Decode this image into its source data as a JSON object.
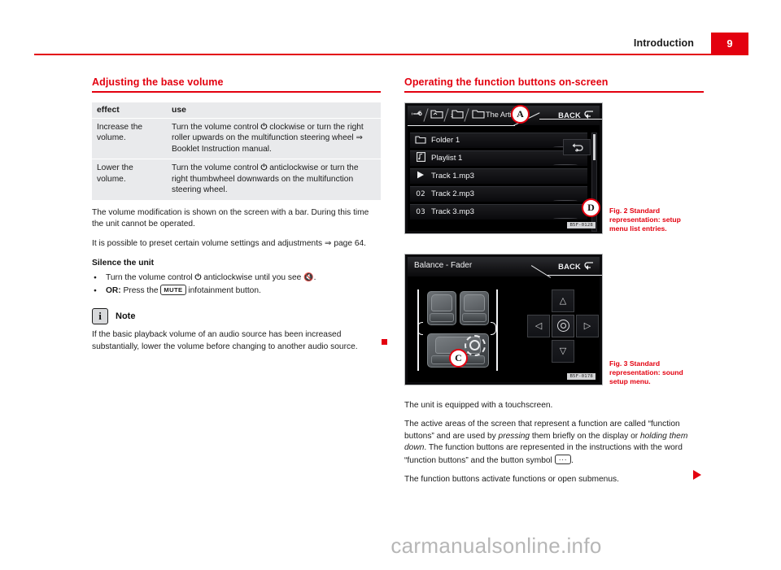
{
  "header": {
    "title": "Introduction",
    "page_number": "9",
    "accent_color": "#e3000f"
  },
  "left_column": {
    "section_title": "Adjusting the base volume",
    "table": {
      "headers": [
        "effect",
        "use"
      ],
      "rows": [
        {
          "effect": "Increase the volume.",
          "use_pre": "Turn the volume control ",
          "use_glyph": "⏻",
          "use_post": " clockwise or turn the right roller upwards on the multifunction steering wheel ⇒ Booklet Instruction manual."
        },
        {
          "effect": "Lower the volume.",
          "use_pre": "Turn the volume control ",
          "use_glyph": "⏻",
          "use_post": " anticlockwise or turn the right thumbwheel downwards on the multifunction steering wheel."
        }
      ]
    },
    "paragraph_1": "The volume modification is shown on the screen with a bar. During this time the unit cannot be operated.",
    "paragraph_2": "It is possible to preset certain volume settings and adjustments ⇒ page 64.",
    "subhead_silence": "Silence the unit",
    "bullets": [
      {
        "pre": "Turn the volume control ",
        "glyph": "⏻",
        "mid": " anticlockwise until you see ",
        "end_glyph": "ὐ7",
        "post": "."
      },
      {
        "bold_prefix": "OR:",
        "pre": " Press the ",
        "key": "MUTE",
        "post": " infotainment button."
      }
    ],
    "note": {
      "icon_glyph": "i",
      "label": "Note",
      "body": "If the basic playback volume of an audio source has been increased substantially, lower the volume before changing to another audio source."
    }
  },
  "right_column": {
    "section_title": "Operating the function buttons on-screen",
    "figure_2": {
      "caption": "Fig. 2   Standard representation: setup menu list entries.",
      "part_number": "B5F-0128",
      "breadcrumb": {
        "icons": [
          "usb-icon",
          "folder-up-icon",
          "folder-up2-icon",
          "folder-icon"
        ],
        "label": "The Artist"
      },
      "back_label": "BACK",
      "back_icon": "back-arrow-icon",
      "callouts": [
        {
          "letter": "A"
        },
        {
          "letter": "D"
        }
      ],
      "list_rows": [
        {
          "lead_icon": "folder-icon",
          "lead_text": "",
          "label": "Folder 1"
        },
        {
          "lead_icon": "playlist-icon",
          "lead_text": "",
          "label": "Playlist 1"
        },
        {
          "lead_icon": "play-icon",
          "lead_text": "",
          "label": "Track 1.mp3"
        },
        {
          "lead_icon": "",
          "lead_text": "02",
          "label": "Track 2.mp3"
        },
        {
          "lead_icon": "",
          "lead_text": "03",
          "label": "Track 3.mp3"
        }
      ],
      "repeat_button_icon": "repeat-icon"
    },
    "figure_3": {
      "caption": "Fig. 3   Standard representation: sound setup menu.",
      "part_number": "B5F-0178",
      "title": "Balance - Fader",
      "back_label": "BACK",
      "back_icon": "back-arrow-icon",
      "callouts": [
        {
          "letter": "C"
        }
      ],
      "dpad": {
        "up": "△",
        "down": "▽",
        "left": "◁",
        "right": "▷",
        "center_icon": "target-icon"
      }
    },
    "paragraph_1": "The unit is equipped with a touchscreen.",
    "paragraph_2": {
      "part_a": "The active areas of the screen that represent a function are called “function buttons” and are used by ",
      "italic_1": "pressing",
      "part_b": " them briefly on the display or ",
      "italic_2": "holding them down",
      "part_c": ". The function buttons are represented in the instructions with the word “function buttons” and the button symbol ",
      "button_symbol": "···",
      "part_d": "."
    },
    "paragraph_3": "The function buttons activate functions or open submenus."
  },
  "watermark": "carmanualsonline.info"
}
